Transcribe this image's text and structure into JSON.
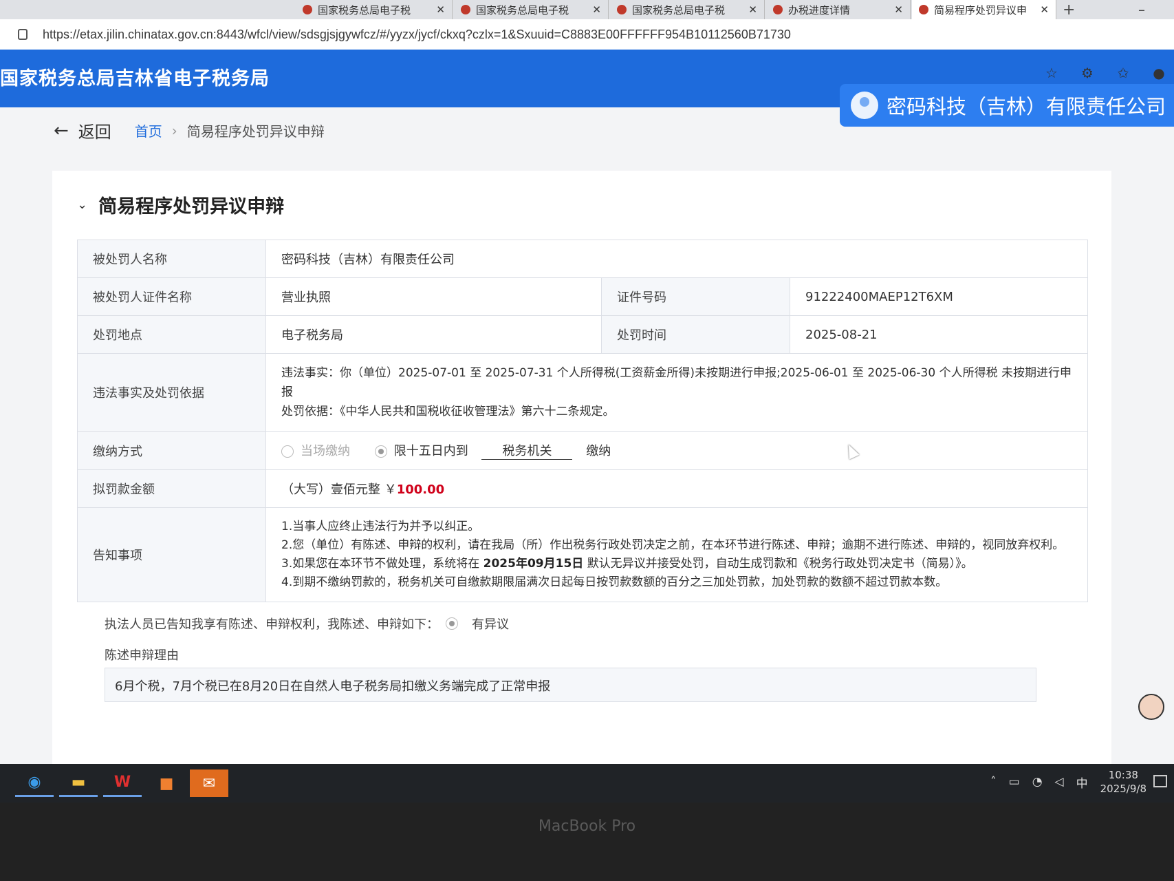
{
  "browser": {
    "tabs": [
      {
        "label": "国家税务总局电子税",
        "active": false
      },
      {
        "label": "国家税务总局电子税",
        "active": false
      },
      {
        "label": "国家税务总局电子税",
        "active": false
      },
      {
        "label": "办税进度详情",
        "active": false
      },
      {
        "label": "简易程序处罚异议申",
        "active": true
      }
    ],
    "url": "https://etax.jilin.chinatax.gov.cn:8443/wfcl/view/sdsgjsjgywfcz/#/yyzx/jycf/ckxq?czlx=1&Sxuuid=C8883E00FFFFFF954B10112560B71730"
  },
  "header": {
    "site_title": "国家税务总局吉林省电子税务局",
    "company_name": "密码科技（吉林）有限责任公司"
  },
  "breadcrumb": {
    "back": "返回",
    "home": "首页",
    "current": "简易程序处罚异议申辩"
  },
  "section": {
    "title": "简易程序处罚异议申辩"
  },
  "form": {
    "penalized_name_label": "被处罚人名称",
    "penalized_name": "密码科技（吉林）有限责任公司",
    "cert_name_label": "被处罚人证件名称",
    "cert_name": "营业执照",
    "cert_no_label": "证件号码",
    "cert_no": "91222400MAEP12T6XM",
    "place_label": "处罚地点",
    "place": "电子税务局",
    "time_label": "处罚时间",
    "time": "2025-08-21",
    "facts_label": "违法事实及处罚依据",
    "facts_line1": "违法事实：你（单位）2025-07-01 至 2025-07-31 个人所得税(工资薪金所得)未按期进行申报;2025-06-01 至 2025-06-30 个人所得税 未按期进行申报",
    "facts_line2": "处罚依据：《中华人民共和国税收征收管理法》第六十二条规定。",
    "pay_label": "缴纳方式",
    "pay_option1": "当场缴纳",
    "pay_option2": "限十五日内到",
    "pay_place": "税务机关",
    "pay_suffix": "缴纳",
    "amount_label": "拟罚款金额",
    "amount_text": "（大写）壹佰元整 ￥",
    "amount_value": "100.00",
    "notice_label": "告知事项",
    "notice1": "1.当事人应终止违法行为并予以纠正。",
    "notice2": "2.您（单位）有陈述、申辩的权利，请在我局（所）作出税务行政处罚决定之前，在本环节进行陈述、申辩；逾期不进行陈述、申辩的，视同放弃权利。",
    "notice3_pre": "3.如果您在本环节不做处理，系统将在",
    "notice3_date": "2025年09月15日",
    "notice3_post": "默认无异议并接受处罚，自动生成罚款和《税务行政处罚决定书（简易）》。",
    "notice4": "4.到期不缴纳罚款的，税务机关可自缴款期限届满次日起每日按罚款数额的百分之三加处罚款，加处罚款的数额不超过罚款本数。"
  },
  "statement": {
    "text": "执法人员已告知我享有陈述、申辩权利，我陈述、申辩如下：",
    "option": "有异议",
    "reason_label": "陈述申辩理由",
    "reason": "6月个税，7月个税已在8月20日在自然人电子税务局扣缴义务端完成了正常申报"
  },
  "taskbar": {
    "apps": [
      "edge-icon",
      "file-explorer-icon",
      "wps-icon",
      "store-icon",
      "wechat-icon"
    ],
    "ime": "中",
    "time": "10:38",
    "date": "2025/9/8"
  },
  "device_label": "MacBook Pro",
  "colors": {
    "header_blue": "#1e6bdc",
    "amount_red": "#d0021b"
  }
}
